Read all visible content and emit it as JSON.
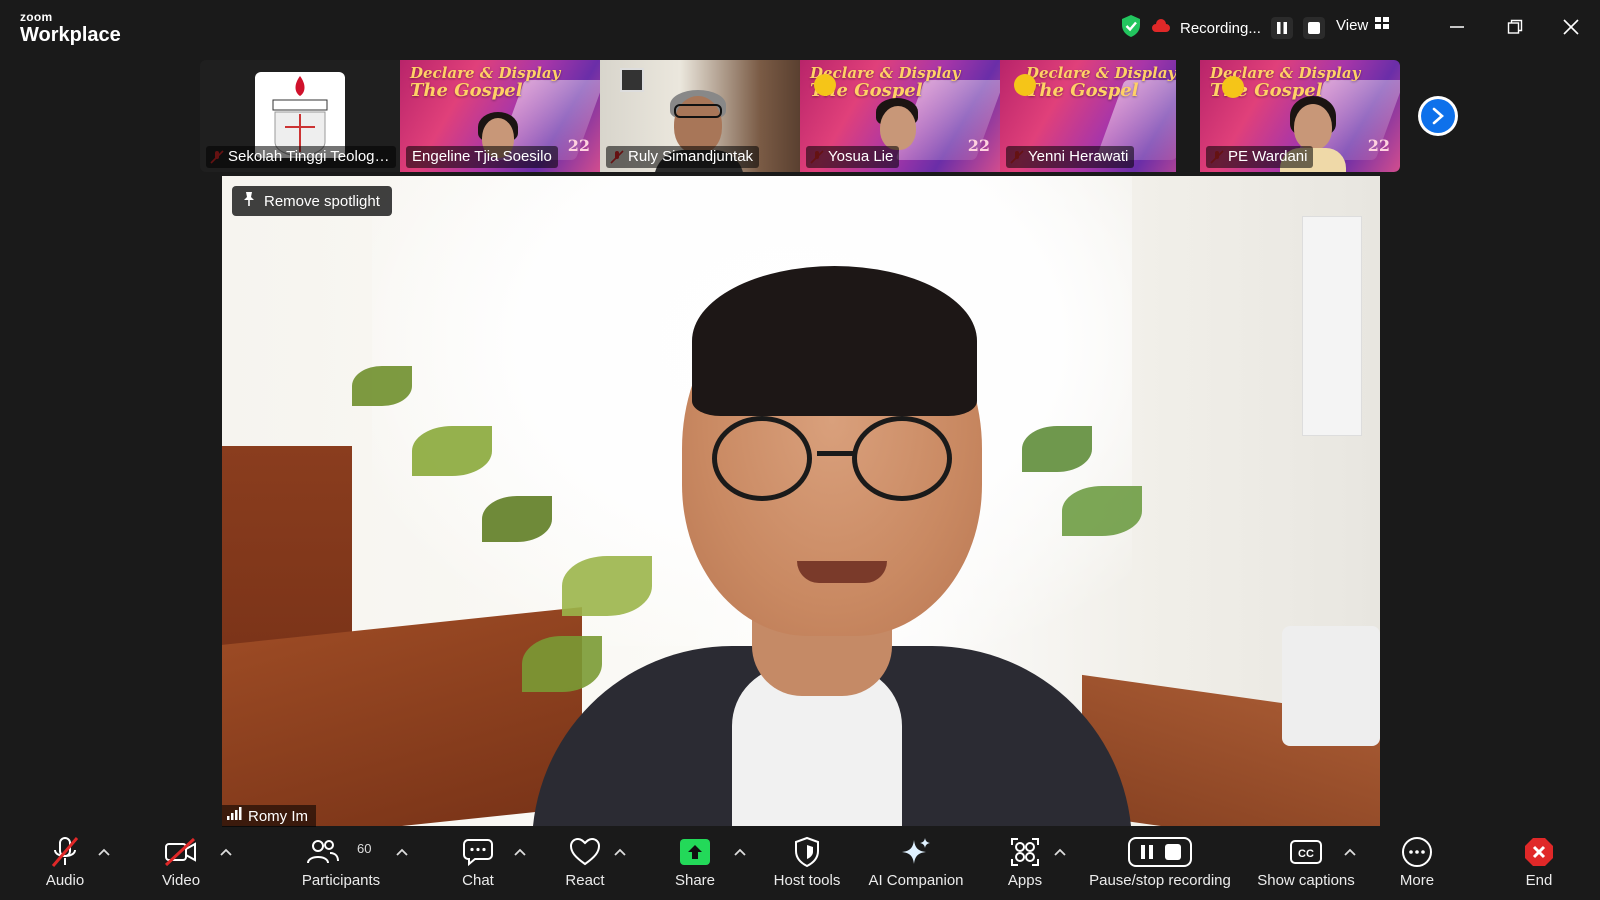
{
  "app": {
    "logo_small": "zoom",
    "logo_big": "Workplace"
  },
  "titlebar": {
    "recording_text": "Recording...",
    "view_label": "View"
  },
  "thumbnails": [
    {
      "name": "Sekolah Tinggi Teologi..."
    },
    {
      "name": "Engeline Tjia Soesilo"
    },
    {
      "name": "Ruly Simandjuntak"
    },
    {
      "name": "Yosua Lie"
    },
    {
      "name": "Yenni Herawati"
    },
    {
      "name": "PE Wardani"
    }
  ],
  "slide": {
    "line1": "Declare & Display",
    "line2": "The Gospel",
    "number": "22"
  },
  "spotlight": {
    "remove_label": "Remove spotlight"
  },
  "speaker": {
    "name": "Romy Im"
  },
  "toolbar": {
    "audio": "Audio",
    "video": "Video",
    "participants": "Participants",
    "participants_count": "60",
    "chat": "Chat",
    "react": "React",
    "share": "Share",
    "host_tools": "Host tools",
    "ai_companion": "AI Companion",
    "apps": "Apps",
    "pause_stop": "Pause/stop recording",
    "captions": "Show captions",
    "more": "More",
    "end": "End"
  },
  "colors": {
    "accent_blue": "#0e71eb",
    "share_green": "#23d959",
    "end_red": "#e02828",
    "shield_green": "#22c55e",
    "mute_red": "#e02828"
  }
}
